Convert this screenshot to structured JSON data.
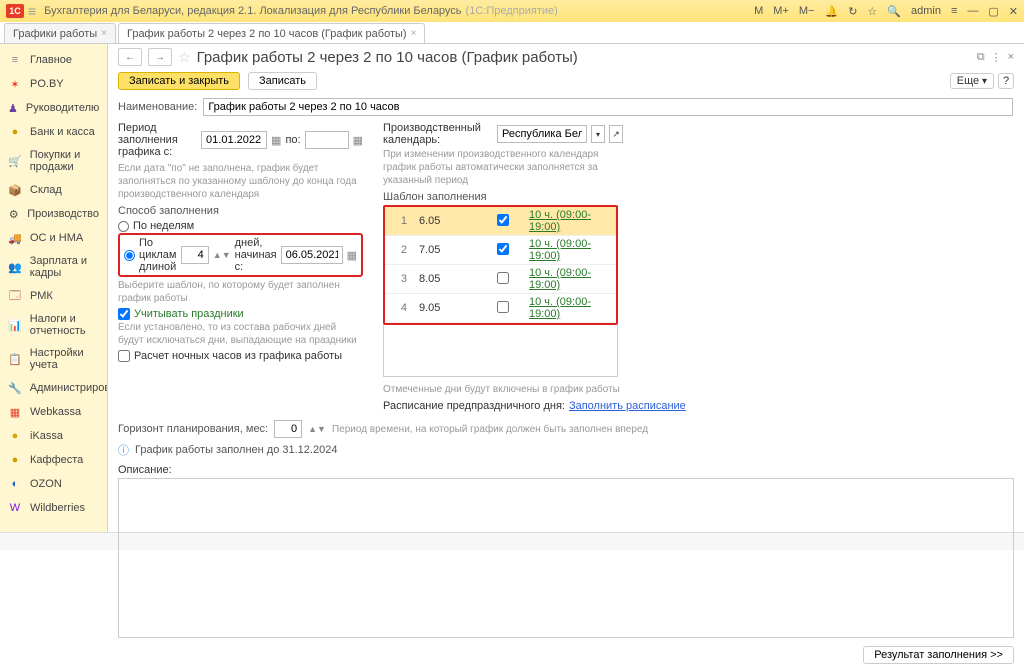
{
  "title": {
    "app": "Бухгалтерия для Беларуси, редакция 2.1. Локализация для Республики Беларусь",
    "suffix": "(1С:Предприятие)",
    "m": "M",
    "mp": "M+",
    "mm": "M−",
    "user": "admin"
  },
  "tabs": [
    {
      "label": "Графики работы"
    },
    {
      "label": "График работы 2 через 2 по 10 часов (График работы)"
    }
  ],
  "sidebar": {
    "items": [
      {
        "ico": "≡",
        "color": "#888",
        "label": "Главное"
      },
      {
        "ico": "✶",
        "color": "#e73c26",
        "label": "PO.BY"
      },
      {
        "ico": "♟",
        "color": "#6b3fa0",
        "label": "Руководителю"
      },
      {
        "ico": "●",
        "color": "#d99a00",
        "label": "Банк и касса"
      },
      {
        "ico": "🛒",
        "color": "#a03a7a",
        "label": "Покупки и продажи"
      },
      {
        "ico": "📦",
        "color": "#6b4a2a",
        "label": "Склад"
      },
      {
        "ico": "⚙",
        "color": "#555",
        "label": "Производство"
      },
      {
        "ico": "🚚",
        "color": "#555",
        "label": "ОС и НМА"
      },
      {
        "ico": "👥",
        "color": "#3a7a3a",
        "label": "Зарплата и кадры"
      },
      {
        "ico": "🗔",
        "color": "#a03a3a",
        "label": "РМК"
      },
      {
        "ico": "📊",
        "color": "#d9843a",
        "label": "Налоги и отчетность"
      },
      {
        "ico": "📋",
        "color": "#5a7a3a",
        "label": "Настройки учета"
      },
      {
        "ico": "🔧",
        "color": "#555",
        "label": "Администрирование"
      },
      {
        "ico": "▦",
        "color": "#e73c26",
        "label": "Webkassa"
      },
      {
        "ico": "●",
        "color": "#d9a300",
        "label": "iKassa"
      },
      {
        "ico": "●",
        "color": "#d99a00",
        "label": "Каффеста"
      },
      {
        "ico": "◐",
        "color": "#1a5fd9",
        "label": "OZON"
      },
      {
        "ico": "W",
        "color": "#7a1ad9",
        "label": "Wildberries"
      }
    ]
  },
  "page": {
    "title": "График работы 2 через 2 по 10 часов (График работы)",
    "save_close": "Записать и закрыть",
    "save": "Записать",
    "more": "Еще",
    "name_label": "Наименование:",
    "name_value": "График работы 2 через 2 по 10 часов",
    "period_label": "Период заполнения графика   с:",
    "period_from": "01.01.2022",
    "period_to_label": "по:",
    "period_note": "Если дата \"по\" не заполнена, график будет заполняться по указанному шаблону до конца года производственного календаря",
    "calendar_label": "Производственный календарь:",
    "calendar_value": "Республика Беларусь",
    "calendar_note": "При изменении производственного календаря график работы автоматически заполняется за указанный период",
    "method_label": "Способ заполнения",
    "radio_weeks": "По неделям",
    "radio_cycles": "По циклам длиной",
    "cycle_len": "4",
    "cycle_days": "дней,   начиная с:",
    "cycle_start": "06.05.2021",
    "template_hint": "Выберите шаблон, по которому будет заполнен график работы",
    "chk_holidays": "Учитывать праздники",
    "holidays_note": "Если установлено, то из состава рабочих дней будут исключаться дни, выпадающие на праздники",
    "chk_night": "Расчет ночных часов из графика работы",
    "template_h": "Шаблон заполнения",
    "rows": [
      {
        "n": "1",
        "d": "6.05",
        "c": true,
        "t": "10 ч. (09:00-19:00)"
      },
      {
        "n": "2",
        "d": "7.05",
        "c": true,
        "t": "10 ч. (09:00-19:00)"
      },
      {
        "n": "3",
        "d": "8.05",
        "c": false,
        "t": "10 ч. (09:00-19:00)"
      },
      {
        "n": "4",
        "d": "9.05",
        "c": false,
        "t": "10 ч. (09:00-19:00)"
      }
    ],
    "marked_note": "Отмеченные дни будут включены в график работы",
    "preholiday_label": "Расписание предпраздничного дня:",
    "preholiday_link": "Заполнить расписание",
    "horizon_label": "Горизонт планирования, мес:",
    "horizon_value": "0",
    "horizon_note": "Период времени, на который график должен быть заполнен вперед",
    "filled_note": "График работы заполнен до 31.12.2024",
    "desc_label": "Описание:",
    "result_btn": "Результат заполнения >>"
  }
}
